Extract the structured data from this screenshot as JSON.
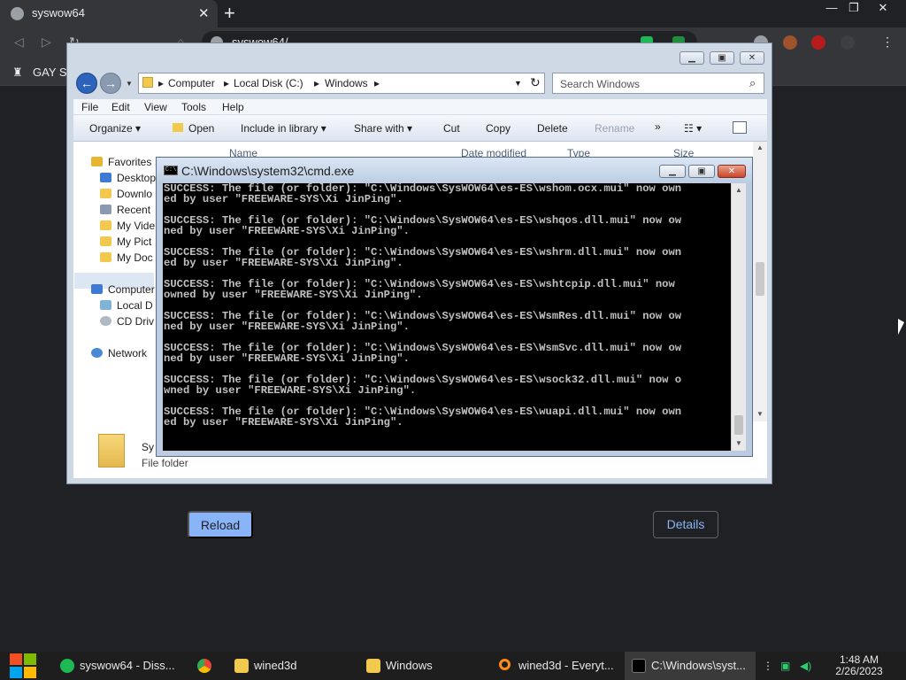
{
  "browser": {
    "tab_title": "syswow64",
    "tab_close": "✕",
    "new_tab": "+",
    "window_min": "—",
    "window_restore": "❐",
    "window_close": "✕",
    "address": "syswow64/",
    "bookmark_label": "GAY S",
    "reload_label": "Reload",
    "details_label": "Details"
  },
  "explorer": {
    "breadcrumb": [
      "Computer",
      "Local Disk (C:)",
      "Windows"
    ],
    "search_placeholder": "Search Windows",
    "menu": [
      "File",
      "Edit",
      "View",
      "Tools",
      "Help"
    ],
    "commands": {
      "organize": "Organize ▾",
      "open": "Open",
      "include": "Include in library ▾",
      "share": "Share with ▾",
      "cut": "Cut",
      "copy": "Copy",
      "delete": "Delete",
      "rename": "Rename",
      "more": "»"
    },
    "columns": [
      "Name",
      "Date modified",
      "Type",
      "Size"
    ],
    "nav": {
      "favorites": "Favorites",
      "desktop": "Desktop",
      "downloads": "Downlo",
      "recent": "Recent",
      "videos": "My Vide",
      "pictures": "My Pict",
      "documents": "My Doc",
      "computer": "Computer",
      "local_disk": "Local D",
      "cd_drive": "CD Driv",
      "network": "Network"
    },
    "file_name": "Sy",
    "file_type": "File folder"
  },
  "cmd": {
    "title": "C:\\Windows\\system32\\cmd.exe",
    "icon_text": "C:\\",
    "lines": [
      "SUCCESS: The file (or folder): \"C:\\Windows\\SysWOW64\\es-ES\\wshom.ocx.mui\" now own\ned by user \"FREEWARE-SYS\\Xi JinPing\".",
      "SUCCESS: The file (or folder): \"C:\\Windows\\SysWOW64\\es-ES\\wshqos.dll.mui\" now ow\nned by user \"FREEWARE-SYS\\Xi JinPing\".",
      "SUCCESS: The file (or folder): \"C:\\Windows\\SysWOW64\\es-ES\\wshrm.dll.mui\" now own\ned by user \"FREEWARE-SYS\\Xi JinPing\".",
      "SUCCESS: The file (or folder): \"C:\\Windows\\SysWOW64\\es-ES\\wshtcpip.dll.mui\" now\nowned by user \"FREEWARE-SYS\\Xi JinPing\".",
      "SUCCESS: The file (or folder): \"C:\\Windows\\SysWOW64\\es-ES\\WsmRes.dll.mui\" now ow\nned by user \"FREEWARE-SYS\\Xi JinPing\".",
      "SUCCESS: The file (or folder): \"C:\\Windows\\SysWOW64\\es-ES\\WsmSvc.dll.mui\" now ow\nned by user \"FREEWARE-SYS\\Xi JinPing\".",
      "SUCCESS: The file (or folder): \"C:\\Windows\\SysWOW64\\es-ES\\wsock32.dll.mui\" now o\nwned by user \"FREEWARE-SYS\\Xi JinPing\".",
      "SUCCESS: The file (or folder): \"C:\\Windows\\SysWOW64\\es-ES\\wuapi.dll.mui\" now own\ned by user \"FREEWARE-SYS\\Xi JinPing\"."
    ]
  },
  "taskbar": {
    "items": [
      {
        "label": "syswow64 - Diss...",
        "icon": "discord-icon",
        "color": "#1db954"
      },
      {
        "label": "",
        "icon": "chrome-icon",
        "color": "#4285f4"
      },
      {
        "label": "wined3d",
        "icon": "folder-icon",
        "color": "#f2c94c"
      },
      {
        "label": "Windows",
        "icon": "folder-icon",
        "color": "#f2c94c"
      },
      {
        "label": "wined3d - Everyt...",
        "icon": "everything-search-icon",
        "color": "#ff8c1a"
      },
      {
        "label": "C:\\Windows\\syst...",
        "icon": "cmd-icon",
        "color": "#000000"
      }
    ],
    "time": "1:48 AM",
    "date": "2/26/2023"
  }
}
